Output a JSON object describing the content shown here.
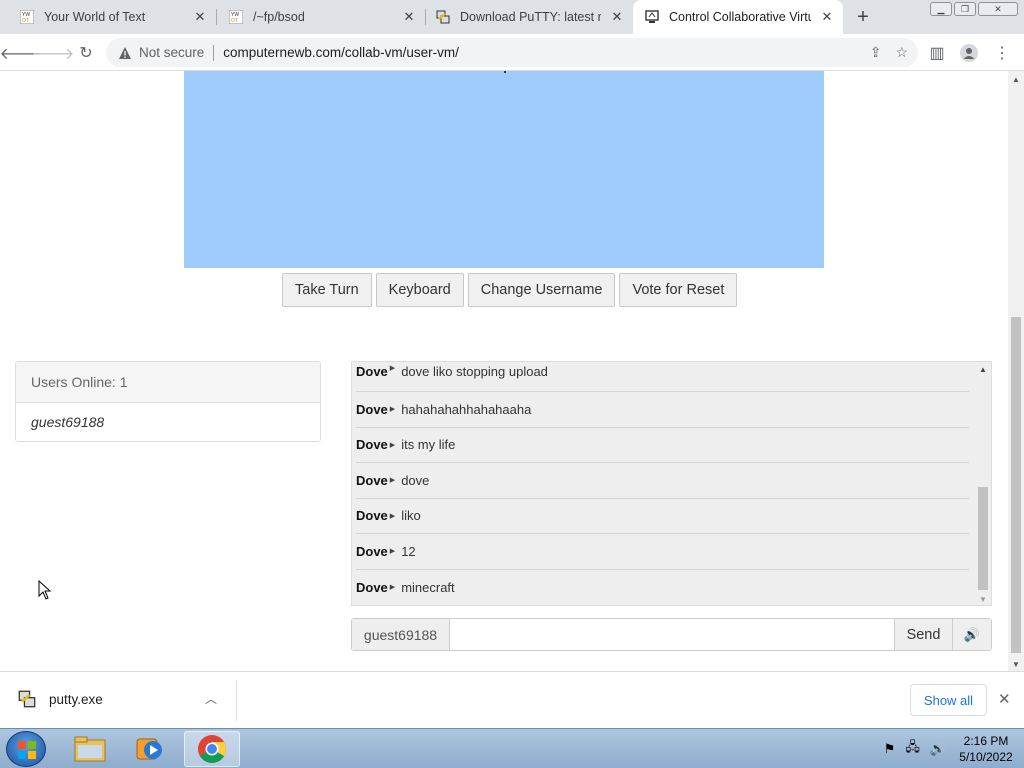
{
  "browser": {
    "tabs": [
      {
        "title": "Your World of Text",
        "favicon": "ywot-favicon"
      },
      {
        "title": "/~fp/bsod",
        "favicon": "ywot-favicon"
      },
      {
        "title": "Download PuTTY: latest rel",
        "favicon": "putty-favicon"
      },
      {
        "title": "Control Collaborative Virtu",
        "favicon": "collabvm-favicon",
        "active": true
      }
    ],
    "new_tab": "+",
    "security_label": "Not secure",
    "url": "computernewb.com/collab-vm/user-vm/"
  },
  "vm": {
    "buttons": {
      "take_turn": "Take Turn",
      "keyboard": "Keyboard",
      "change_username": "Change Username",
      "vote_reset": "Vote for Reset"
    },
    "screen_color": "#9fcbfa"
  },
  "users": {
    "header": "Users Online: 1",
    "list": [
      "guest69188"
    ]
  },
  "chat": {
    "messages": [
      {
        "user": "Dove",
        "text": "dove liko stopping upload"
      },
      {
        "user": "Dove",
        "text": "hahahahahhahahaaha"
      },
      {
        "user": "Dove",
        "text": "its my life"
      },
      {
        "user": "Dove",
        "text": "dove"
      },
      {
        "user": "Dove",
        "text": "liko"
      },
      {
        "user": "Dove",
        "text": "12"
      },
      {
        "user": "Dove",
        "text": "minecraft"
      }
    ],
    "username": "guest69188",
    "input_value": "",
    "send_label": "Send"
  },
  "downloads": {
    "file": "putty.exe",
    "show_all": "Show all"
  },
  "taskbar": {
    "time": "2:16 PM",
    "date": "5/10/2022"
  }
}
